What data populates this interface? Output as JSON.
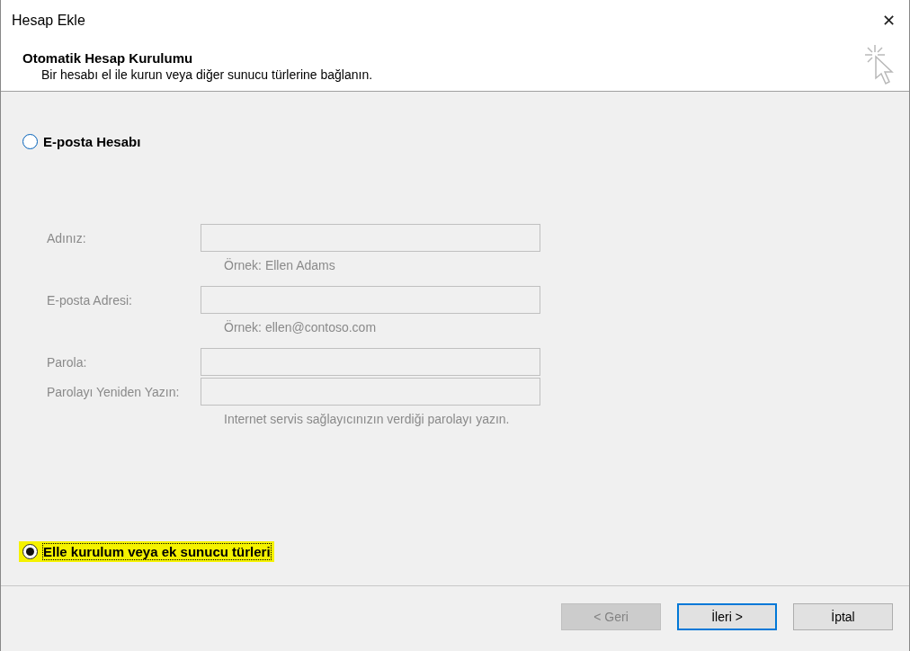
{
  "window": {
    "title": "Hesap Ekle",
    "close": "✕"
  },
  "header": {
    "title": "Otomatik Hesap Kurulumu",
    "subtitle": "Bir hesabı el ile kurun veya diğer sunucu türlerine bağlanın."
  },
  "options": [
    {
      "label": "E-posta Hesabı",
      "selected": false,
      "highlighted": false
    },
    {
      "label": "Elle kurulum veya ek sunucu türleri",
      "selected": true,
      "highlighted": true
    }
  ],
  "form": {
    "disabled": true,
    "fields": [
      {
        "label": "Adınız:",
        "hint": "Örnek: Ellen Adams"
      },
      {
        "label": "E-posta Adresi:",
        "hint": "Örnek: ellen@contoso.com"
      },
      {
        "label": "Parola:"
      },
      {
        "label": "Parolayı Yeniden Yazın:",
        "hint": "Internet servis sağlayıcınızın verdiği parolayı yazın."
      }
    ]
  },
  "buttons": [
    {
      "label": "< Geri",
      "disabled": true,
      "default": false
    },
    {
      "label": "İleri >",
      "disabled": false,
      "default": true
    },
    {
      "label": "İptal",
      "disabled": false,
      "default": false
    }
  ]
}
